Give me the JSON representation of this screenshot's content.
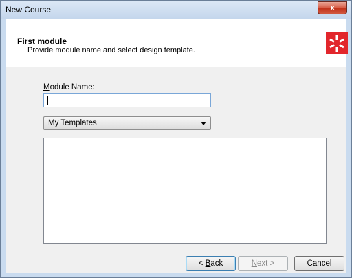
{
  "window": {
    "title": "New Course",
    "close_glyph": "x"
  },
  "header": {
    "title": "First module",
    "subtitle": "Provide module name and select design template.",
    "logo_color": "#e2262c"
  },
  "module_name": {
    "label_accel": "M",
    "label_rest": "odule Name:",
    "value": ""
  },
  "template_select": {
    "selected": "My Templates"
  },
  "buttons": {
    "back_accel": "B",
    "back_prefix": "< ",
    "back_rest": "ack",
    "next_accel": "N",
    "next_rest": "ext >",
    "cancel": "Cancel"
  }
}
